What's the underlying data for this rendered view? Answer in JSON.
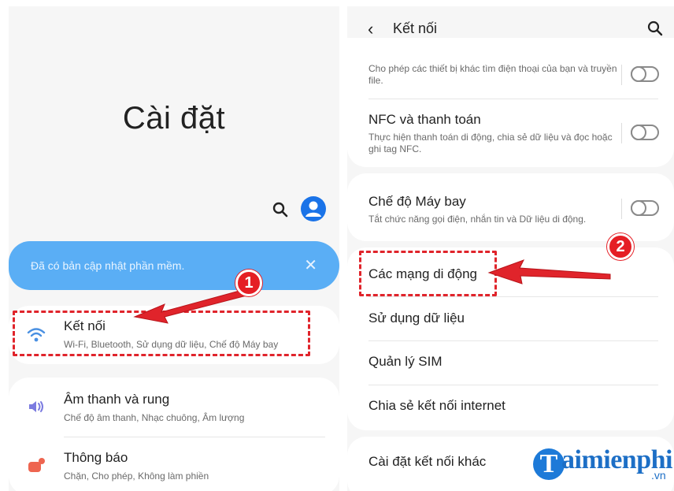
{
  "left": {
    "title": "Cài đặt",
    "banner": {
      "text": "Đã có bản cập nhật phần mềm."
    },
    "items": [
      {
        "title": "Kết nối",
        "subtitle": "Wi-Fi, Bluetooth, Sử dụng dữ liệu, Chế độ Máy bay",
        "icon": "wifi-icon"
      },
      {
        "title": "Âm thanh và rung",
        "subtitle": "Chế độ âm thanh, Nhạc chuông, Âm lượng",
        "icon": "speaker-icon"
      },
      {
        "title": "Thông báo",
        "subtitle": "Chặn, Cho phép, Không làm phiền",
        "icon": "notification-icon"
      }
    ],
    "annotation_number": "1"
  },
  "right": {
    "header_title": "Kết nối",
    "items": [
      {
        "title": "",
        "subtitle": "Cho phép các thiết bị khác tìm điện thoại của bạn và truyền file."
      },
      {
        "title": "NFC và thanh toán",
        "subtitle": "Thực hiện thanh toán di động, chia sẻ dữ liệu và đọc hoặc ghi tag NFC."
      },
      {
        "title": "Chế độ Máy bay",
        "subtitle": "Tắt chức năng gọi điện, nhắn tin và Dữ liệu di động."
      },
      {
        "title": "Các mạng di động"
      },
      {
        "title": "Sử dụng dữ liệu"
      },
      {
        "title": "Quản lý SIM"
      },
      {
        "title": "Chia sẻ kết nối internet"
      },
      {
        "title": "Cài đặt kết nối khác"
      }
    ],
    "annotation_number": "2"
  },
  "watermark": {
    "letter": "T",
    "name": "aimienphi",
    "suffix": ".vn"
  },
  "colors": {
    "accent": "#1a73e8",
    "banner": "#5aaef5",
    "annotation": "#e0242b"
  }
}
